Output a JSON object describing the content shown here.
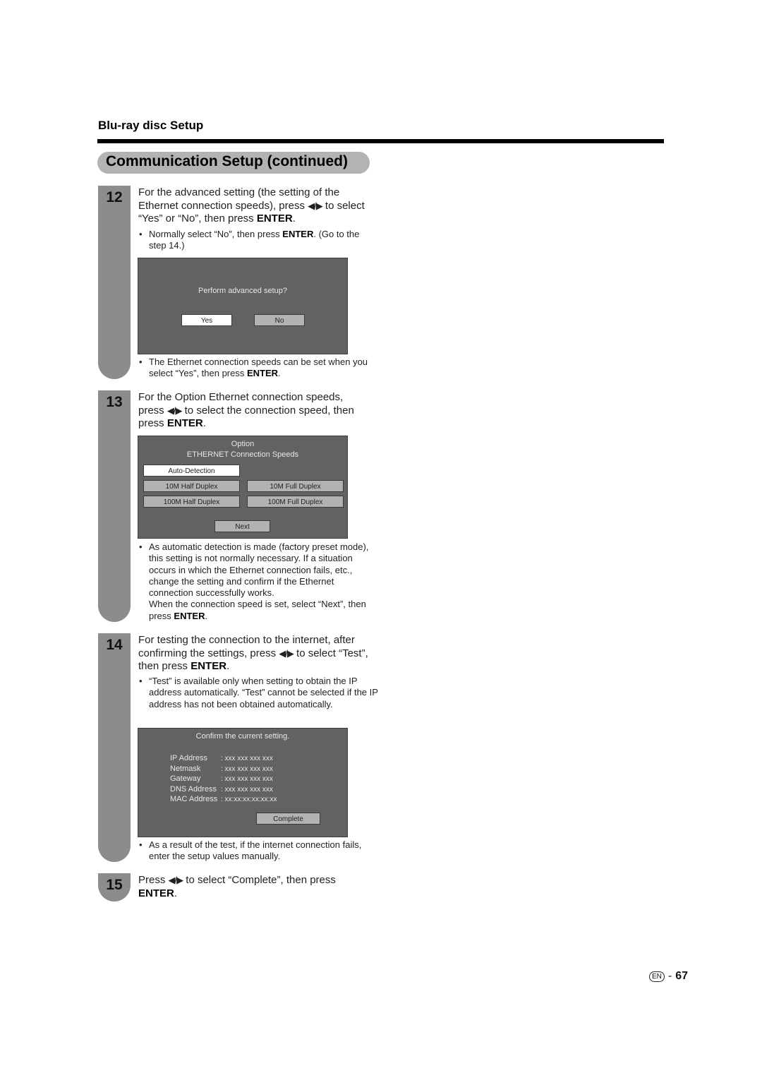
{
  "header": {
    "section": "Blu-ray disc Setup",
    "title": "Communication Setup (continued)"
  },
  "steps": [
    {
      "number": "12",
      "main_pre": "For the advanced setting (the setting of the Ethernet connection speeds), press ",
      "main_mid": " to select “Yes” or “No”, then press ",
      "main_enter": "ENTER",
      "main_post": ".",
      "bullet1_pre": "Normally select “No”, then press ",
      "bullet1_enter": "ENTER",
      "bullet1_post": ". (Go to the step 14.)",
      "screen": {
        "prompt": "Perform advanced setup?",
        "yes": "Yes",
        "no": "No"
      },
      "bullet2_pre": "The Ethernet connection speeds can be set when you select “Yes”, then press ",
      "bullet2_enter": "ENTER",
      "bullet2_post": "."
    },
    {
      "number": "13",
      "main_pre": "For the Option Ethernet connection speeds, press ",
      "main_mid": " to select the connection speed, then press ",
      "main_enter": "ENTER",
      "main_post": ".",
      "screen": {
        "title1": "Option",
        "title2": "ETHERNET Connection Speeds",
        "auto": "Auto-Detection",
        "half10": "10M Half Duplex",
        "full10": "10M Full Duplex",
        "half100": "100M Half Duplex",
        "full100": "100M Full Duplex",
        "next": "Next"
      },
      "bullet_text": "As automatic detection is made (factory preset mode), this setting is not normally necessary. If a situation occurs in which the Ethernet connection fails, etc., change the setting and confirm if the Ethernet connection successfully works.",
      "bullet_text2_pre": "When the connection speed is set, select “Next”, then press ",
      "bullet_enter": "ENTER",
      "bullet_post": "."
    },
    {
      "number": "14",
      "main_pre": "For testing the connection to the internet, after confirming the settings, press ",
      "main_mid": " to select “Test”, then press ",
      "main_enter": "ENTER",
      "main_post": ".",
      "bullet1": "“Test” is available only when setting to obtain the IP address automatically. “Test” cannot be selected if the IP address has not been obtained automatically.",
      "screen": {
        "title": "Confirm the current setting.",
        "rows": [
          {
            "label": "IP Address",
            "value": ": xxx xxx xxx xxx"
          },
          {
            "label": "Netmask",
            "value": ": xxx xxx xxx xxx"
          },
          {
            "label": "Gateway",
            "value": ": xxx xxx xxx xxx"
          },
          {
            "label": "DNS Address",
            "value": ": xxx xxx xxx xxx"
          },
          {
            "label": "MAC Address",
            "value": ": xx:xx:xx:xx:xx:xx"
          }
        ],
        "complete": "Complete"
      },
      "bullet2": "As a result of the test, if the internet connection fails, enter the setup values manually."
    },
    {
      "number": "15",
      "main_pre": "Press ",
      "main_mid": " to select “Complete”, then press ",
      "main_enter": "ENTER",
      "main_post": "."
    }
  ],
  "arrows": "◀/▶",
  "bullet_dot": "•",
  "footer": {
    "lang_badge": "EN",
    "separator": "-",
    "page_number": "67"
  }
}
